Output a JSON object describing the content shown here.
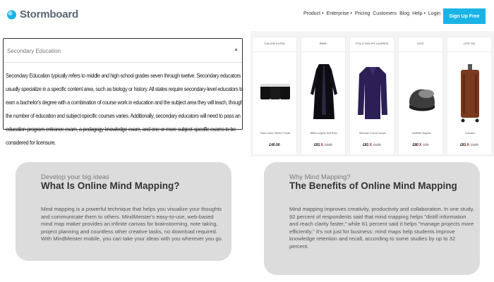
{
  "header": {
    "logo_text": "Stormboard",
    "nav": [
      "Product •",
      "Enterprise •",
      "Pricing",
      "Customers",
      "Blog",
      "Help •",
      "Login →"
    ],
    "signup_label": "Sign Up Free"
  },
  "accordion": {
    "title": "Secondary Education",
    "chevron": "▲",
    "body": "Secondary Education typically refers to middle and high school grades seven through twelve. Secondary educators usually specialize in a specific content area, such as biology or history. All states require secondary-level educators to earn a bachelor's degree with a combination of course work in education and the subject area they will teach, though the number of education and subject-specific courses varies. Additionally, secondary educators will need to pass an education program entrance exam, a pedagogy knowledge exam, and one or more subject-specific exams to be considered for licensure."
  },
  "products": [
    {
      "brand": "CALVIN KLEIN",
      "name": "Pack Cotton Stretch Trunks",
      "price": "£40.00",
      "old": "",
      "icon": "trunks-icon"
    },
    {
      "brand": "BIBA",
      "name": "BIBA Longline Soft Robe",
      "price": "£81",
      "old": "£135",
      "icon": "robe-icon"
    },
    {
      "brand": "POLO RALPH LAUREN",
      "name": "Shimmer V-neck Jumper",
      "price": "£81",
      "old": "£135",
      "icon": "jumper-icon"
    },
    {
      "brand": "UGG",
      "name": "Scuffette Slippers",
      "price": "£80",
      "old": "£95",
      "icon": "slipper-icon"
    },
    {
      "brand": "LIFE SA",
      "name": "Suitcase",
      "price": "£81",
      "old": "£135",
      "icon": "suitcase-icon"
    }
  ],
  "cards": {
    "left": {
      "kicker": "Develop your big ideas",
      "title": "What Is Online Mind Mapping?",
      "body": "Mind mapping is a powerful technique that helps you visualize your thoughts and communicate them to others. MindMeister's easy-to-use, web-based mind map maker provides an infinite canvas for brainstorming, note taking, project planning and countless other creative tasks, no download required. With MindMeister mobile, you can take your ideas with you wherever you go."
    },
    "right": {
      "kicker": "Why Mind Mapping?",
      "title": "The Benefits of Online Mind Mapping",
      "body": "Mind mapping improves creativity, productivity and collaboration. In one study, 92 percent of respondents said that mind mapping helps \"distill information and reach clarity faster,\" while 81 percent said it helps \"manage projects more efficiently.\" It's not just for business: mind maps help students improve knowledge retention and recall, according to some studies by up to 32 percent."
    }
  },
  "colors": {
    "accent": "#19b3e6",
    "card_bg": "#dcdcdc",
    "price_mark": "#cc0000"
  }
}
